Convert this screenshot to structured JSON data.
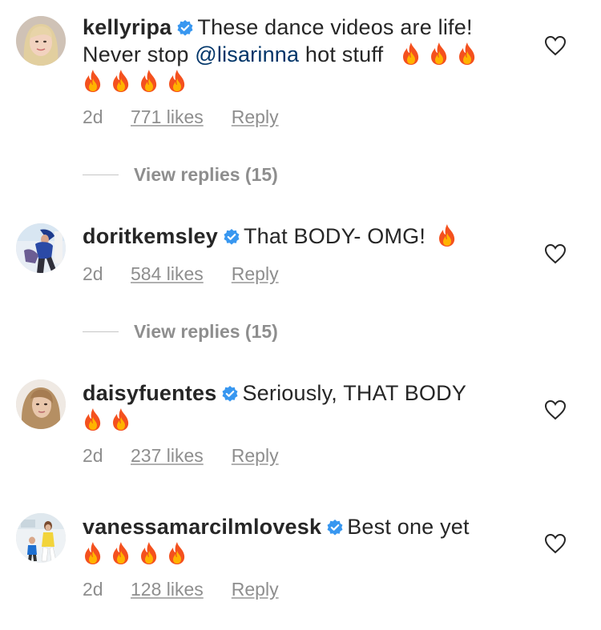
{
  "comments": [
    {
      "username": "kellyripa",
      "text_before": "These dance videos are life!",
      "line2_prefix": "Never stop ",
      "mention": "@lisarinna",
      "line2_suffix": " hot stuff",
      "time": "2d",
      "likes": "771 likes",
      "reply": "Reply",
      "view_replies": "View replies (15)"
    },
    {
      "username": "doritkemsley",
      "text": "That BODY- OMG!",
      "time": "2d",
      "likes": "584 likes",
      "reply": "Reply",
      "view_replies": "View replies (15)"
    },
    {
      "username": "daisyfuentes",
      "text": "Seriously, THAT BODY",
      "time": "2d",
      "likes": "237 likes",
      "reply": "Reply"
    },
    {
      "username": "vanessamarcilmlovesk",
      "text": "Best one yet",
      "time": "2d",
      "likes": "128 likes",
      "reply": "Reply"
    }
  ],
  "icons": {
    "verified": "verified-badge-icon",
    "heart": "heart-outline-icon",
    "fire": "fire-emoji-icon"
  },
  "colors": {
    "verified": "#3897f0",
    "mention": "#003569",
    "meta": "#8e8e8e",
    "text": "#262626"
  }
}
